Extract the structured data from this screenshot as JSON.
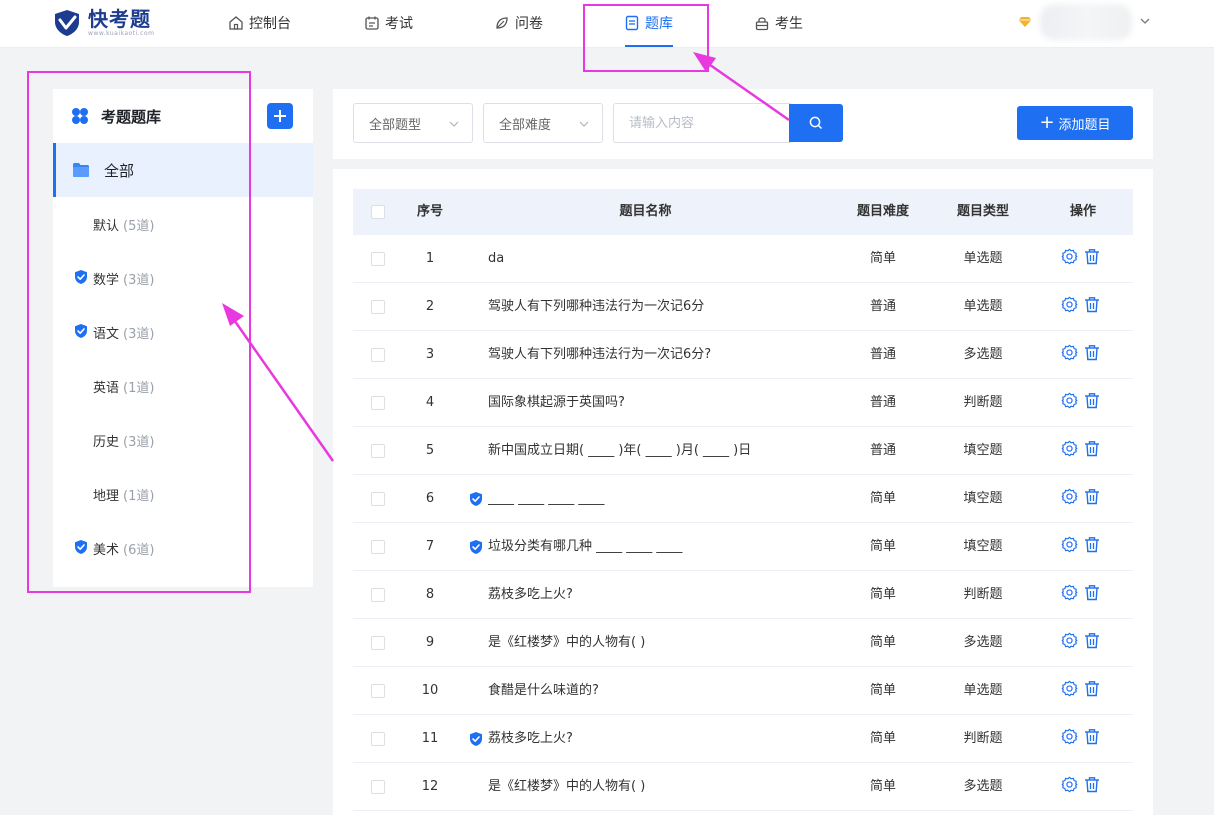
{
  "header": {
    "logo_name": "快考题",
    "logo_sub": "www.kuaikaoti.com",
    "nav": [
      {
        "label": "控制台",
        "icon": "home-icon"
      },
      {
        "label": "考试",
        "icon": "calendar-icon"
      },
      {
        "label": "问卷",
        "icon": "leaf-icon"
      },
      {
        "label": "题库",
        "icon": "book-icon",
        "active": true
      },
      {
        "label": "考生",
        "icon": "lock-icon"
      }
    ],
    "accent": "#1e6ff1"
  },
  "sidebar": {
    "title": "考题题库",
    "all_label": "全部",
    "items": [
      {
        "name": "默认",
        "count": "(5道)",
        "verified": false
      },
      {
        "name": "数学",
        "count": "(3道)",
        "verified": true
      },
      {
        "name": "语文",
        "count": "(3道)",
        "verified": true
      },
      {
        "name": "英语",
        "count": "(1道)",
        "verified": false
      },
      {
        "name": "历史",
        "count": "(3道)",
        "verified": false
      },
      {
        "name": "地理",
        "count": "(1道)",
        "verified": false
      },
      {
        "name": "美术",
        "count": "(6道)",
        "verified": true
      }
    ]
  },
  "toolbar": {
    "type_select": "全部题型",
    "difficulty_select": "全部难度",
    "search_placeholder": "请输入内容",
    "add_button": "添加题目"
  },
  "table": {
    "columns": [
      "序号",
      "题目名称",
      "题目难度",
      "题目类型",
      "操作"
    ],
    "rows": [
      {
        "no": "1",
        "title": "da",
        "difficulty": "简单",
        "type": "单选题",
        "verified": false
      },
      {
        "no": "2",
        "title": "驾驶人有下列哪种违法行为一次记6分",
        "difficulty": "普通",
        "type": "单选题",
        "verified": false
      },
      {
        "no": "3",
        "title": "驾驶人有下列哪种违法行为一次记6分?",
        "difficulty": "普通",
        "type": "多选题",
        "verified": false
      },
      {
        "no": "4",
        "title": "国际象棋起源于英国吗?",
        "difficulty": "普通",
        "type": "判断题",
        "verified": false
      },
      {
        "no": "5",
        "title": "新中国成立日期( ____ )年( ____ )月( ____ )日",
        "difficulty": "普通",
        "type": "填空题",
        "verified": false
      },
      {
        "no": "6",
        "title": "____ ____ ____ ____",
        "difficulty": "简单",
        "type": "填空题",
        "verified": true
      },
      {
        "no": "7",
        "title": "垃圾分类有哪几种 ____ ____ ____",
        "difficulty": "简单",
        "type": "填空题",
        "verified": true
      },
      {
        "no": "8",
        "title": "荔枝多吃上火?",
        "difficulty": "简单",
        "type": "判断题",
        "verified": false
      },
      {
        "no": "9",
        "title": "是《红楼梦》中的人物有(   )",
        "difficulty": "简单",
        "type": "多选题",
        "verified": false
      },
      {
        "no": "10",
        "title": "食醋是什么味道的?",
        "difficulty": "简单",
        "type": "单选题",
        "verified": false
      },
      {
        "no": "11",
        "title": "荔枝多吃上火?",
        "difficulty": "简单",
        "type": "判断题",
        "verified": true
      },
      {
        "no": "12",
        "title": "是《红楼梦》中的人物有(   )",
        "difficulty": "简单",
        "type": "多选题",
        "verified": false
      }
    ]
  }
}
